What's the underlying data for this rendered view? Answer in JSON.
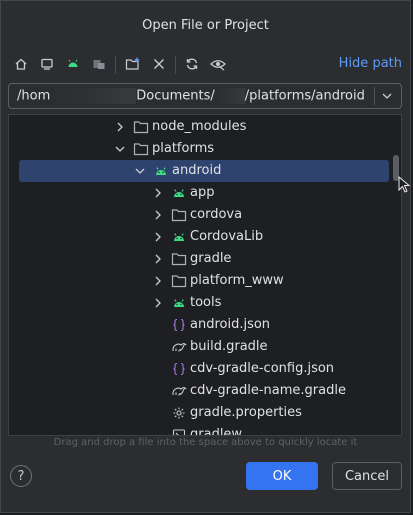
{
  "dialog": {
    "title": "Open File or Project"
  },
  "toolbar": {
    "buttons": [
      {
        "name": "home-icon"
      },
      {
        "name": "desktop-icon"
      },
      {
        "name": "android-project-icon"
      },
      {
        "name": "module-icon"
      },
      {
        "name": "new-folder-icon"
      },
      {
        "name": "delete-icon"
      },
      {
        "name": "refresh-icon"
      },
      {
        "name": "show-hidden-icon"
      }
    ],
    "hide_path_label": "Hide path"
  },
  "path": {
    "part1": "/hom",
    "part2": "Documents/",
    "part3": "/platforms/android"
  },
  "tree": {
    "rows": [
      {
        "label": "node_modules",
        "icon": "folder-icon",
        "chevron": "right",
        "indent": 1,
        "selected": false
      },
      {
        "label": "platforms",
        "icon": "folder-icon",
        "chevron": "down",
        "indent": 1,
        "selected": false
      },
      {
        "label": "android",
        "icon": "android-module-icon",
        "chevron": "down",
        "indent": 2,
        "selected": true
      },
      {
        "label": "app",
        "icon": "android-module-icon",
        "chevron": "right",
        "indent": 3,
        "selected": false
      },
      {
        "label": "cordova",
        "icon": "folder-icon",
        "chevron": "right",
        "indent": 3,
        "selected": false
      },
      {
        "label": "CordovaLib",
        "icon": "android-module-icon",
        "chevron": "right",
        "indent": 3,
        "selected": false
      },
      {
        "label": "gradle",
        "icon": "folder-icon",
        "chevron": "right",
        "indent": 3,
        "selected": false
      },
      {
        "label": "platform_www",
        "icon": "folder-icon",
        "chevron": "right",
        "indent": 3,
        "selected": false
      },
      {
        "label": "tools",
        "icon": "android-module-icon",
        "chevron": "right",
        "indent": 3,
        "selected": false
      },
      {
        "label": "android.json",
        "icon": "json-file-icon",
        "chevron": "none",
        "indent": 3,
        "selected": false
      },
      {
        "label": "build.gradle",
        "icon": "gradle-file-icon",
        "chevron": "none",
        "indent": 3,
        "selected": false
      },
      {
        "label": "cdv-gradle-config.json",
        "icon": "json-file-icon",
        "chevron": "none",
        "indent": 3,
        "selected": false
      },
      {
        "label": "cdv-gradle-name.gradle",
        "icon": "gradle-file-icon",
        "chevron": "none",
        "indent": 3,
        "selected": false
      },
      {
        "label": "gradle.properties",
        "icon": "settings-file-icon",
        "chevron": "none",
        "indent": 3,
        "selected": false
      },
      {
        "label": "gradlew",
        "icon": "script-file-icon",
        "chevron": "none",
        "indent": 3,
        "selected": false
      }
    ]
  },
  "hint_text": "Drag and drop a file into the space above to quickly locate it",
  "buttons": {
    "help": "?",
    "ok": "OK",
    "cancel": "Cancel"
  },
  "colors": {
    "accent": "#3574f0",
    "link": "#5c9df6",
    "android": "#3ddc84",
    "selection": "#2e436e"
  }
}
